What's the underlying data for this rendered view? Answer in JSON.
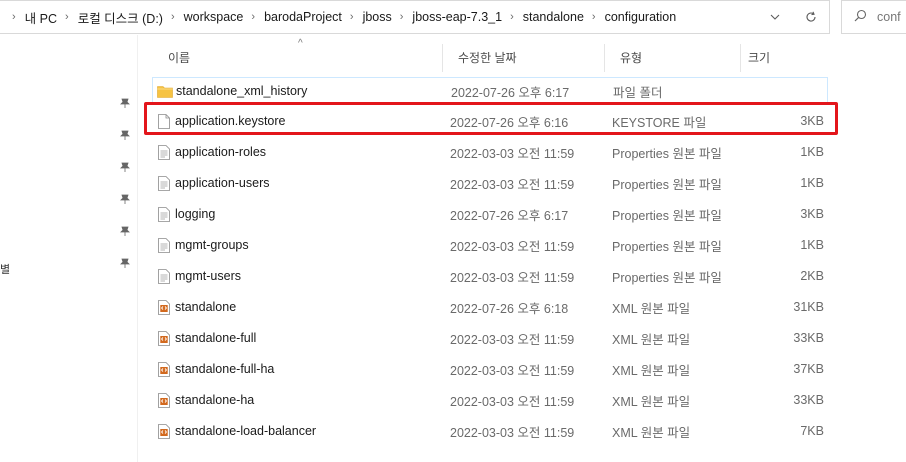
{
  "address": {
    "crumbs": [
      "내 PC",
      "로컬 디스크 (D:)",
      "workspace",
      "barodaProject",
      "jboss",
      "jboss-eap-7.3_1",
      "standalone",
      "configuration"
    ],
    "separator": "›",
    "dropdown_icon": "chevron-down-icon",
    "refresh_icon": "refresh-icon"
  },
  "search": {
    "placeholder": "conf"
  },
  "columns": {
    "name": "이름",
    "date": "수정한 날짜",
    "type": "유형",
    "size": "크기"
  },
  "files": [
    {
      "icon": "folder-icon",
      "name": "standalone_xml_history",
      "date": "2022-07-26 오후 6:17",
      "type": "파일 폴더",
      "size": ""
    },
    {
      "icon": "file-icon",
      "name": "application.keystore",
      "date": "2022-07-26 오후 6:16",
      "type": "KEYSTORE 파일",
      "size": "3KB"
    },
    {
      "icon": "text-file-icon",
      "name": "application-roles",
      "date": "2022-03-03 오전 11:59",
      "type": "Properties 원본 파일",
      "size": "1KB"
    },
    {
      "icon": "text-file-icon",
      "name": "application-users",
      "date": "2022-03-03 오전 11:59",
      "type": "Properties 원본 파일",
      "size": "1KB"
    },
    {
      "icon": "text-file-icon",
      "name": "logging",
      "date": "2022-07-26 오후 6:17",
      "type": "Properties 원본 파일",
      "size": "3KB"
    },
    {
      "icon": "text-file-icon",
      "name": "mgmt-groups",
      "date": "2022-03-03 오전 11:59",
      "type": "Properties 원본 파일",
      "size": "1KB"
    },
    {
      "icon": "text-file-icon",
      "name": "mgmt-users",
      "date": "2022-03-03 오전 11:59",
      "type": "Properties 원본 파일",
      "size": "2KB"
    },
    {
      "icon": "xml-file-icon",
      "name": "standalone",
      "date": "2022-07-26 오후 6:18",
      "type": "XML 원본 파일",
      "size": "31KB"
    },
    {
      "icon": "xml-file-icon",
      "name": "standalone-full",
      "date": "2022-03-03 오전 11:59",
      "type": "XML 원본 파일",
      "size": "33KB"
    },
    {
      "icon": "xml-file-icon",
      "name": "standalone-full-ha",
      "date": "2022-03-03 오전 11:59",
      "type": "XML 원본 파일",
      "size": "37KB"
    },
    {
      "icon": "xml-file-icon",
      "name": "standalone-ha",
      "date": "2022-03-03 오전 11:59",
      "type": "XML 원본 파일",
      "size": "33KB"
    },
    {
      "icon": "xml-file-icon",
      "name": "standalone-load-balancer",
      "date": "2022-03-03 오전 11:59",
      "type": "XML 원본 파일",
      "size": "7KB"
    }
  ],
  "nav": {
    "pin_icon": "pin-icon",
    "edge_text": "별"
  },
  "colors": {
    "highlight": "#e3151b",
    "folder": "#f6c342",
    "xml": "#d2691e",
    "selection_border": "#cde8ff"
  }
}
